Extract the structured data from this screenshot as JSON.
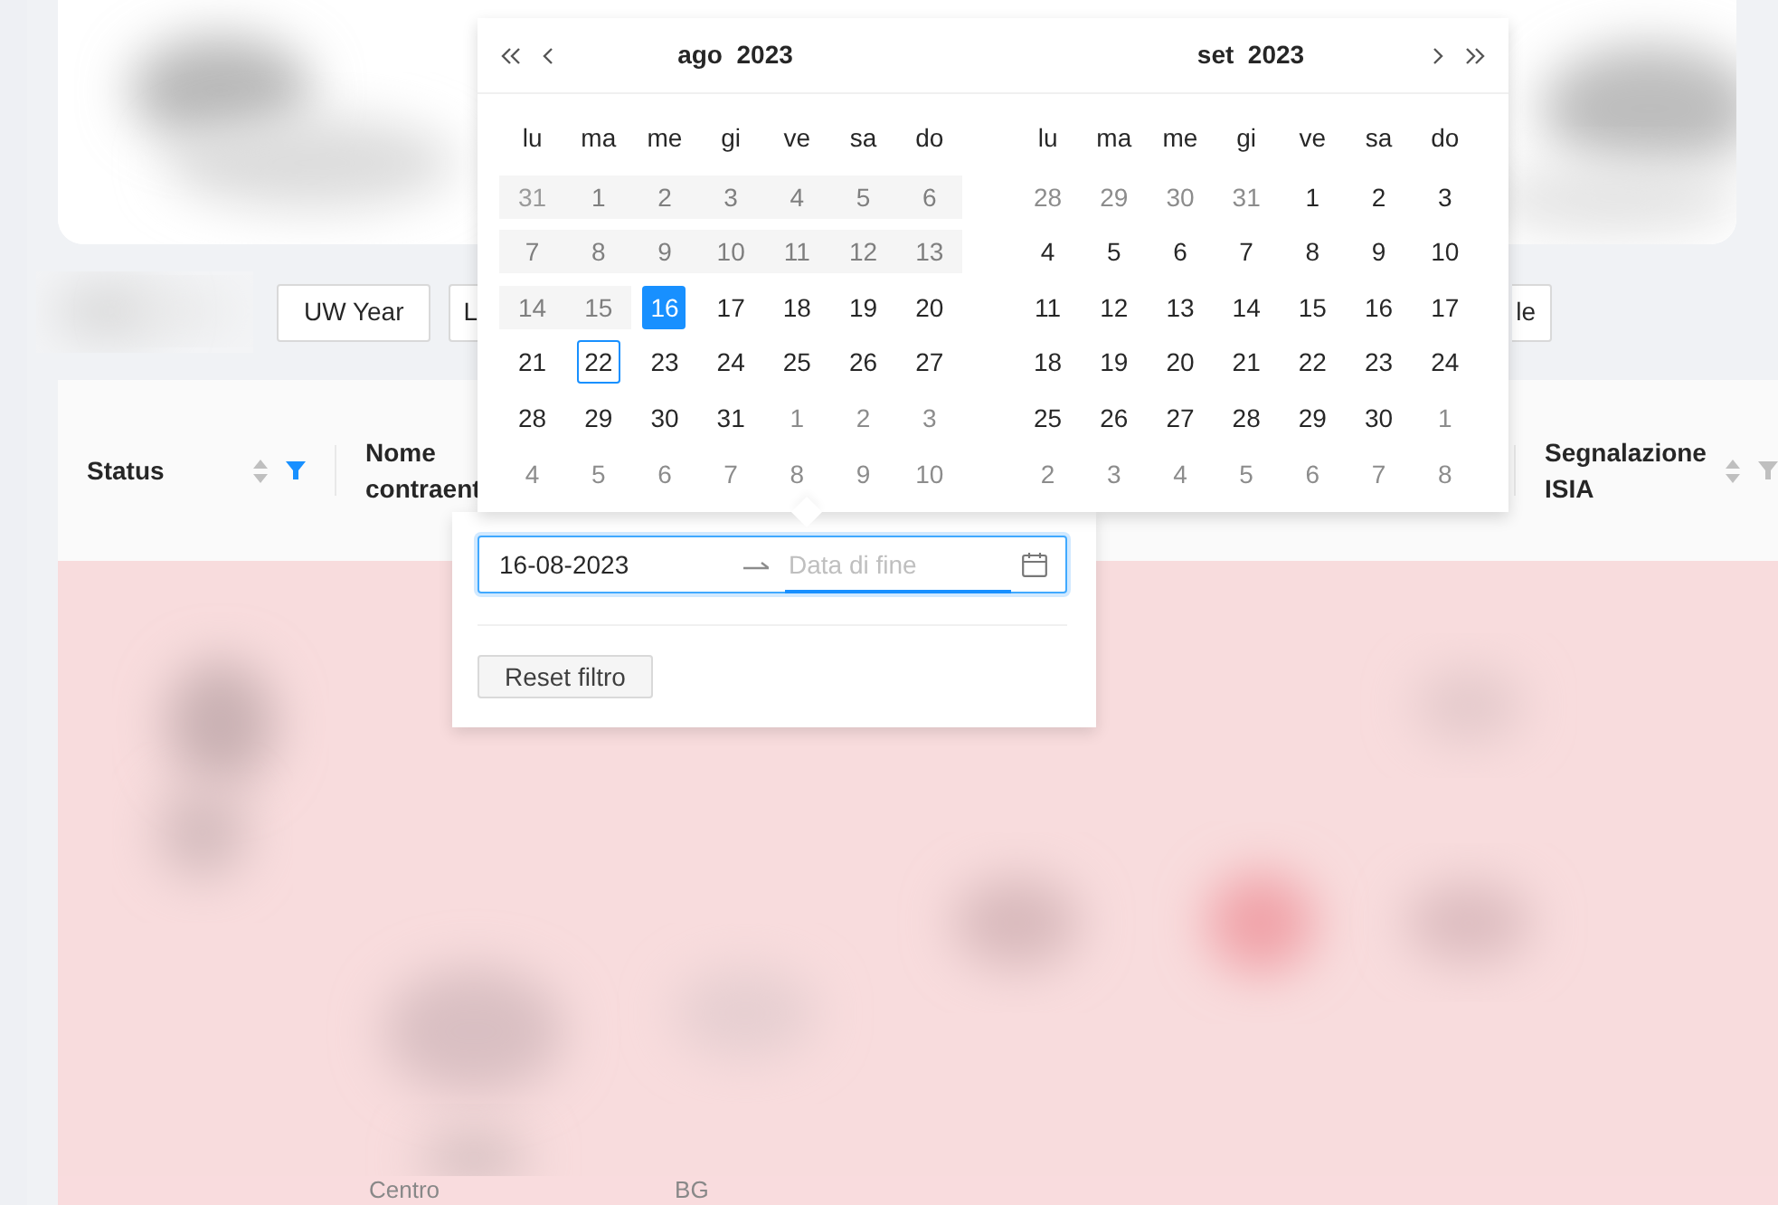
{
  "filter_buttons": [
    {
      "label": "UW Year",
      "kind": "full"
    },
    {
      "label": "L",
      "kind": "cut_right"
    },
    {
      "label": "le",
      "kind": "cut_left"
    }
  ],
  "table": {
    "columns": [
      {
        "label": "Status",
        "kind": "sortable",
        "filter_active": true
      },
      {
        "label": "Nome contraent",
        "kind": "plain"
      },
      {
        "label": "Segnalazione ISIA",
        "kind": "sortable",
        "filter_active": false
      }
    ],
    "footer_cells": [
      "Centro",
      "BG"
    ]
  },
  "date_filter": {
    "start_value": "16-08-2023",
    "end_placeholder": "Data di fine",
    "reset_label": "Reset filtro",
    "months": [
      {
        "title": "ago  2023",
        "weekdays": [
          "lu",
          "ma",
          "me",
          "gi",
          "ve",
          "sa",
          "do"
        ],
        "weeks": [
          [
            {
              "day": "31",
              "outside": true,
              "disabled": true,
              "selected": false,
              "today": false
            },
            {
              "day": "1",
              "outside": false,
              "disabled": true,
              "selected": false,
              "today": false
            },
            {
              "day": "2",
              "outside": false,
              "disabled": true,
              "selected": false,
              "today": false
            },
            {
              "day": "3",
              "outside": false,
              "disabled": true,
              "selected": false,
              "today": false
            },
            {
              "day": "4",
              "outside": false,
              "disabled": true,
              "selected": false,
              "today": false
            },
            {
              "day": "5",
              "outside": false,
              "disabled": true,
              "selected": false,
              "today": false
            },
            {
              "day": "6",
              "outside": false,
              "disabled": true,
              "selected": false,
              "today": false
            }
          ],
          [
            {
              "day": "7",
              "outside": false,
              "disabled": true,
              "selected": false,
              "today": false
            },
            {
              "day": "8",
              "outside": false,
              "disabled": true,
              "selected": false,
              "today": false
            },
            {
              "day": "9",
              "outside": false,
              "disabled": true,
              "selected": false,
              "today": false
            },
            {
              "day": "10",
              "outside": false,
              "disabled": true,
              "selected": false,
              "today": false
            },
            {
              "day": "11",
              "outside": false,
              "disabled": true,
              "selected": false,
              "today": false
            },
            {
              "day": "12",
              "outside": false,
              "disabled": true,
              "selected": false,
              "today": false
            },
            {
              "day": "13",
              "outside": false,
              "disabled": true,
              "selected": false,
              "today": false
            }
          ],
          [
            {
              "day": "14",
              "outside": false,
              "disabled": true,
              "selected": false,
              "today": false
            },
            {
              "day": "15",
              "outside": false,
              "disabled": true,
              "selected": false,
              "today": false
            },
            {
              "day": "16",
              "outside": false,
              "disabled": false,
              "selected": true,
              "today": false
            },
            {
              "day": "17",
              "outside": false,
              "disabled": false,
              "selected": false,
              "today": false
            },
            {
              "day": "18",
              "outside": false,
              "disabled": false,
              "selected": false,
              "today": false
            },
            {
              "day": "19",
              "outside": false,
              "disabled": false,
              "selected": false,
              "today": false
            },
            {
              "day": "20",
              "outside": false,
              "disabled": false,
              "selected": false,
              "today": false
            }
          ],
          [
            {
              "day": "21",
              "outside": false,
              "disabled": false,
              "selected": false,
              "today": false
            },
            {
              "day": "22",
              "outside": false,
              "disabled": false,
              "selected": false,
              "today": true
            },
            {
              "day": "23",
              "outside": false,
              "disabled": false,
              "selected": false,
              "today": false
            },
            {
              "day": "24",
              "outside": false,
              "disabled": false,
              "selected": false,
              "today": false
            },
            {
              "day": "25",
              "outside": false,
              "disabled": false,
              "selected": false,
              "today": false
            },
            {
              "day": "26",
              "outside": false,
              "disabled": false,
              "selected": false,
              "today": false
            },
            {
              "day": "27",
              "outside": false,
              "disabled": false,
              "selected": false,
              "today": false
            }
          ],
          [
            {
              "day": "28",
              "outside": false,
              "disabled": false,
              "selected": false,
              "today": false
            },
            {
              "day": "29",
              "outside": false,
              "disabled": false,
              "selected": false,
              "today": false
            },
            {
              "day": "30",
              "outside": false,
              "disabled": false,
              "selected": false,
              "today": false
            },
            {
              "day": "31",
              "outside": false,
              "disabled": false,
              "selected": false,
              "today": false
            },
            {
              "day": "1",
              "outside": true,
              "disabled": false,
              "selected": false,
              "today": false
            },
            {
              "day": "2",
              "outside": true,
              "disabled": false,
              "selected": false,
              "today": false
            },
            {
              "day": "3",
              "outside": true,
              "disabled": false,
              "selected": false,
              "today": false
            }
          ],
          [
            {
              "day": "4",
              "outside": true,
              "disabled": false,
              "selected": false,
              "today": false
            },
            {
              "day": "5",
              "outside": true,
              "disabled": false,
              "selected": false,
              "today": false
            },
            {
              "day": "6",
              "outside": true,
              "disabled": false,
              "selected": false,
              "today": false
            },
            {
              "day": "7",
              "outside": true,
              "disabled": false,
              "selected": false,
              "today": false
            },
            {
              "day": "8",
              "outside": true,
              "disabled": false,
              "selected": false,
              "today": false
            },
            {
              "day": "9",
              "outside": true,
              "disabled": false,
              "selected": false,
              "today": false
            },
            {
              "day": "10",
              "outside": true,
              "disabled": false,
              "selected": false,
              "today": false
            }
          ]
        ]
      },
      {
        "title": "set  2023",
        "weekdays": [
          "lu",
          "ma",
          "me",
          "gi",
          "ve",
          "sa",
          "do"
        ],
        "weeks": [
          [
            {
              "day": "28",
              "outside": true,
              "disabled": false,
              "selected": false,
              "today": false
            },
            {
              "day": "29",
              "outside": true,
              "disabled": false,
              "selected": false,
              "today": false
            },
            {
              "day": "30",
              "outside": true,
              "disabled": false,
              "selected": false,
              "today": false
            },
            {
              "day": "31",
              "outside": true,
              "disabled": false,
              "selected": false,
              "today": false
            },
            {
              "day": "1",
              "outside": false,
              "disabled": false,
              "selected": false,
              "today": false
            },
            {
              "day": "2",
              "outside": false,
              "disabled": false,
              "selected": false,
              "today": false
            },
            {
              "day": "3",
              "outside": false,
              "disabled": false,
              "selected": false,
              "today": false
            }
          ],
          [
            {
              "day": "4",
              "outside": false,
              "disabled": false,
              "selected": false,
              "today": false
            },
            {
              "day": "5",
              "outside": false,
              "disabled": false,
              "selected": false,
              "today": false
            },
            {
              "day": "6",
              "outside": false,
              "disabled": false,
              "selected": false,
              "today": false
            },
            {
              "day": "7",
              "outside": false,
              "disabled": false,
              "selected": false,
              "today": false
            },
            {
              "day": "8",
              "outside": false,
              "disabled": false,
              "selected": false,
              "today": false
            },
            {
              "day": "9",
              "outside": false,
              "disabled": false,
              "selected": false,
              "today": false
            },
            {
              "day": "10",
              "outside": false,
              "disabled": false,
              "selected": false,
              "today": false
            }
          ],
          [
            {
              "day": "11",
              "outside": false,
              "disabled": false,
              "selected": false,
              "today": false
            },
            {
              "day": "12",
              "outside": false,
              "disabled": false,
              "selected": false,
              "today": false
            },
            {
              "day": "13",
              "outside": false,
              "disabled": false,
              "selected": false,
              "today": false
            },
            {
              "day": "14",
              "outside": false,
              "disabled": false,
              "selected": false,
              "today": false
            },
            {
              "day": "15",
              "outside": false,
              "disabled": false,
              "selected": false,
              "today": false
            },
            {
              "day": "16",
              "outside": false,
              "disabled": false,
              "selected": false,
              "today": false
            },
            {
              "day": "17",
              "outside": false,
              "disabled": false,
              "selected": false,
              "today": false
            }
          ],
          [
            {
              "day": "18",
              "outside": false,
              "disabled": false,
              "selected": false,
              "today": false
            },
            {
              "day": "19",
              "outside": false,
              "disabled": false,
              "selected": false,
              "today": false
            },
            {
              "day": "20",
              "outside": false,
              "disabled": false,
              "selected": false,
              "today": false
            },
            {
              "day": "21",
              "outside": false,
              "disabled": false,
              "selected": false,
              "today": false
            },
            {
              "day": "22",
              "outside": false,
              "disabled": false,
              "selected": false,
              "today": false
            },
            {
              "day": "23",
              "outside": false,
              "disabled": false,
              "selected": false,
              "today": false
            },
            {
              "day": "24",
              "outside": false,
              "disabled": false,
              "selected": false,
              "today": false
            }
          ],
          [
            {
              "day": "25",
              "outside": false,
              "disabled": false,
              "selected": false,
              "today": false
            },
            {
              "day": "26",
              "outside": false,
              "disabled": false,
              "selected": false,
              "today": false
            },
            {
              "day": "27",
              "outside": false,
              "disabled": false,
              "selected": false,
              "today": false
            },
            {
              "day": "28",
              "outside": false,
              "disabled": false,
              "selected": false,
              "today": false
            },
            {
              "day": "29",
              "outside": false,
              "disabled": false,
              "selected": false,
              "today": false
            },
            {
              "day": "30",
              "outside": false,
              "disabled": false,
              "selected": false,
              "today": false
            },
            {
              "day": "1",
              "outside": true,
              "disabled": false,
              "selected": false,
              "today": false
            }
          ],
          [
            {
              "day": "2",
              "outside": true,
              "disabled": false,
              "selected": false,
              "today": false
            },
            {
              "day": "3",
              "outside": true,
              "disabled": false,
              "selected": false,
              "today": false
            },
            {
              "day": "4",
              "outside": true,
              "disabled": false,
              "selected": false,
              "today": false
            },
            {
              "day": "5",
              "outside": true,
              "disabled": false,
              "selected": false,
              "today": false
            },
            {
              "day": "6",
              "outside": true,
              "disabled": false,
              "selected": false,
              "today": false
            },
            {
              "day": "7",
              "outside": true,
              "disabled": false,
              "selected": false,
              "today": false
            },
            {
              "day": "8",
              "outside": true,
              "disabled": false,
              "selected": false,
              "today": false
            }
          ]
        ]
      }
    ]
  }
}
